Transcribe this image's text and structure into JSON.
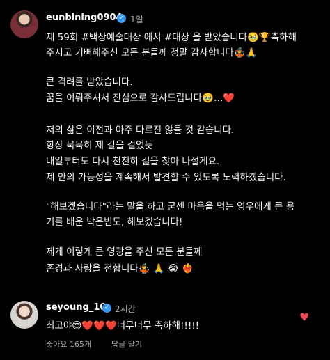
{
  "post": {
    "username": "eunbining0904",
    "time": "1일",
    "lines": [
      "제 59회 #백상예술대상 에서 #대상 을 받았습니다🥹🏆축하해",
      "주시고 기뻐해주신 모든 분들께 정말 감사합니다🤹🙏",
      "큰 격려를 받았습니다.",
      "꿈을 이뤄주셔서 진심으로 감사드립니다🥹…❤️",
      "저의 삶은 이전과 아주 다르진 않을 것 같습니다.",
      "항상 묵묵히 제 길을 걸었듯",
      "내일부터도 다시 천천히 길을 찾아 나설게요.",
      "제 안의 가능성을 계속해서 발견할 수 있도록 노력하겠습니다.",
      "\"해보겠습니다\"라는 말을 하고 굳센 마음을 먹는 영우에게 큰 용",
      "기를 배운 박은빈도, 해보겠습니다!",
      "제게 이렇게 큰 영광을 주신 모든 분들께",
      "존경과 사랑을 전합니다🤹 🙏 😭 ❤️‍🔥"
    ]
  },
  "comment": {
    "username": "seyoung_10",
    "time": "2시간",
    "text": "최고야😍❤️❤️❤️너무너무 축하해!!!!!",
    "likes": "좋아요 165개",
    "reply": "답글 달기"
  },
  "icons": {
    "verified": "verified-badge-icon",
    "like": "heart-icon"
  },
  "colors": {
    "background": "#000000",
    "verified": "#3897f0",
    "heart": "#ed4956",
    "secondary_text": "#a8a8a8"
  }
}
